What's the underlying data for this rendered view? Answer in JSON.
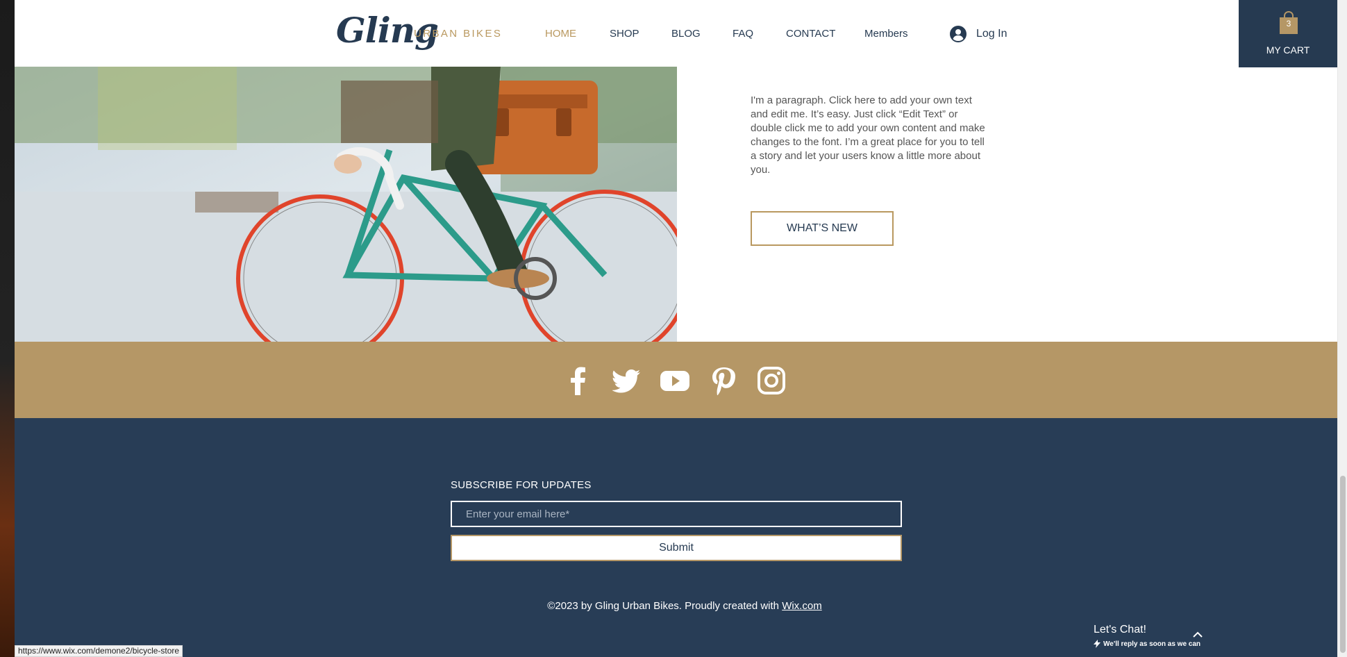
{
  "header": {
    "logo": "Gling",
    "logo_sub": "URBAN BIKES",
    "nav": [
      {
        "label": "HOME",
        "active": true
      },
      {
        "label": "SHOP",
        "active": false
      },
      {
        "label": "BLOG",
        "active": false
      },
      {
        "label": "FAQ",
        "active": false
      },
      {
        "label": "CONTACT",
        "active": false
      },
      {
        "label": "Members",
        "active": false
      }
    ],
    "login_label": "Log In",
    "cart": {
      "count": "3",
      "label": "MY CART"
    }
  },
  "content": {
    "paragraph": "I'm a paragraph. Click here to add your own text and edit me. It’s easy. Just click “Edit Text” or double click me to add your own content and make changes to the font. I’m a great place for you to tell a story and let your users know a little more about you.",
    "whats_new_label": "WHAT’S NEW"
  },
  "social": {
    "icons": [
      "facebook-icon",
      "twitter-icon",
      "youtube-icon",
      "pinterest-icon",
      "instagram-icon"
    ]
  },
  "footer": {
    "subscribe_title": "SUBSCRIBE FOR UPDATES",
    "email_placeholder": "Enter your email here*",
    "submit_label": "Submit",
    "copyright_prefix": "©2023 by Gling Urban Bikes. Proudly created with ",
    "copyright_link": "Wix.com"
  },
  "chat": {
    "title": "Let's Chat!",
    "subtitle": "We'll reply as soon as we can"
  },
  "status_url": "https://www.wix.com/demone2/bicycle-store",
  "colors": {
    "navy": "#263a51",
    "gold": "#b9985f",
    "band": "#b59766",
    "footer": "#283d56"
  }
}
